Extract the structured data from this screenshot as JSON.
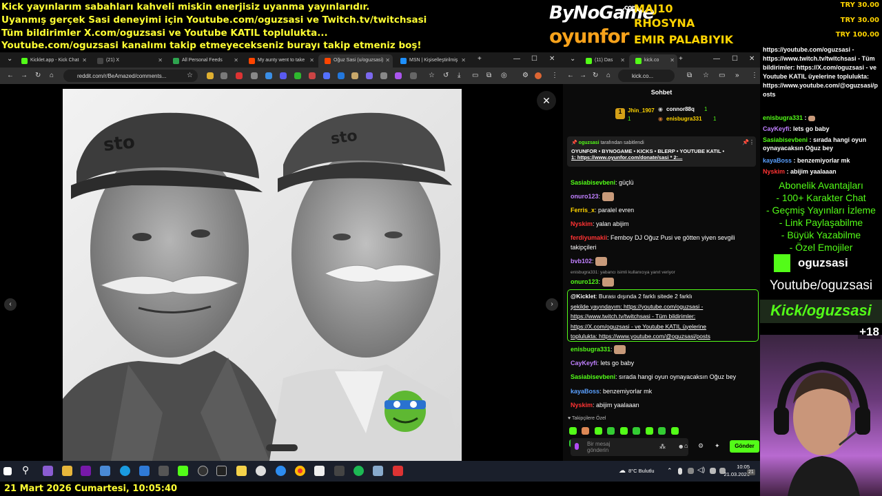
{
  "banner": {
    "lines": [
      "Kick yayınlarım sabahları kahveli miskin enerjisiz uyanma yayınlarıdır.",
      "Uyanmış gerçek Sasi deneyimi için Youtube.com/oguzsasi ve Twitch.tv/twitchsasi",
      "Tüm bildirimler X.com/oguzsasi ve Youtube KATIL toplulukta...",
      "Youtube.com/oguzsasi kanalımı takip etmeyecekseniz burayı takip etmeniz boş!"
    ],
    "logo_bynogame": "ByNoGame",
    "logo_bynogame_suffix": ".com",
    "logo_oyunfor": "oyunfor",
    "donors": [
      {
        "name": "MAJ10",
        "amount": "TRY 30.00"
      },
      {
        "name": "RHOSYNA",
        "amount": "TRY 30.00"
      },
      {
        "name": "EMIR PALABIYIK",
        "amount": "TRY 100.00"
      }
    ]
  },
  "left_browser": {
    "tabs": [
      {
        "label": "Kicklet.app - Kick Chat",
        "color": "#53fc18"
      },
      {
        "label": "(21) X",
        "color": "#000000"
      },
      {
        "label": "All Personal Feeds",
        "color": "#2ea44f"
      },
      {
        "label": "My aunty went to take",
        "color": "#ff4500"
      },
      {
        "label": "Oğuz Sasi (u/oguzsasi)",
        "color": "#ff4500"
      },
      {
        "label": "MSN | Kişiselleştirilmiş",
        "color": "#1e90ff"
      }
    ],
    "url": "reddit.com/r/BeAmazed/comments...",
    "close_label": "✕",
    "prev_label": "‹",
    "next_label": "›"
  },
  "right_browser": {
    "tabs": [
      {
        "label": "(11) Das",
        "color": "#53fc18"
      },
      {
        "label": "kick.co",
        "color": "#53fc18"
      }
    ],
    "url": "kick.co...",
    "chat_title": "Sohbet",
    "podium": {
      "first": {
        "name": "Jhin_1907",
        "count": "1"
      },
      "second": {
        "name": "connor88q",
        "count": "1"
      },
      "third": {
        "name": "enisbugra331",
        "count": "1"
      }
    },
    "pinned": {
      "by": "oguzsasi",
      "by_suffix": "tarafından sabitlendi",
      "line1": "OYUNFOR • BYNOGAME • KICKS • BLERP • YOUTUBE KATIL •",
      "line2": "1: https://www.oyunfor.com/donate/sasi * 2:..."
    },
    "messages": [
      {
        "user": "Sasiabisevbeni",
        "color": "#53fc18",
        "text": "güçlü"
      },
      {
        "user": "onuro123",
        "color": "#53fc18",
        "text": ""
      },
      {
        "user": "Ferris_x",
        "color": "#ffd400",
        "text": "paralel evren"
      },
      {
        "user": "Nyskim",
        "color": "#ff3333",
        "text": "yalan abijim"
      },
      {
        "user": "ferdiyumakii",
        "color": "#ff3333",
        "text": "Femboy DJ Oğuz Pusi ve götten yiyen sevgili takipçileri"
      },
      {
        "user": "bvb102",
        "color": "#c080ff",
        "text": ""
      },
      {
        "user": "onuro123",
        "color": "#53fc18",
        "text": ""
      }
    ],
    "reply_note": "enisbugra331: yabancı isimli kullanıcıya yanıt veriyor",
    "kicklet": {
      "user": "@Kicklet",
      "text1": "Burası dışında 2 farklı sitede 2 farklı",
      "text2": "şekilde yayındayım: https://youtube.com/oguzsasi -",
      "text3": "https://www.twitch.tv/twitchsasi - Tüm bildirimler:",
      "text4": "https://X.com/oguzsasi - ve Youtube KATIL üyelerine",
      "text5": "toplulukta: https://www.youtube.com/@oguzsasi/posts"
    },
    "messages2": [
      {
        "user": "enisbugra331",
        "color": "#53fc18",
        "text": ""
      },
      {
        "user": "CayKeyfi",
        "color": "#c080ff",
        "text": "lets go baby"
      },
      {
        "user": "Sasiabisevbeni",
        "color": "#53fc18",
        "text": "sırada hangi oyun oynayacaksın Oğuz bey"
      },
      {
        "user": "kayaBoss",
        "color": "#5aa0ff",
        "text": "benzemiyorlar mk"
      },
      {
        "user": "Nyskim",
        "color": "#ff3333",
        "text": "abijim yaalaaan"
      }
    ],
    "followers_label": "Takipçilere Özel",
    "input_placeholder": "Bir mesaj gönderin",
    "send_label": "Gönder"
  },
  "side_column": {
    "top_chat": [
      "https://youtube.com/oguzsasi -",
      "https://www.twitch.tv/twitchsasi - Tüm",
      "bildirimler: https://X.com/oguzsasi - ve",
      "Youtube KATIL üyelerine topluluktа:",
      "https://www.youtube.com/@oguzsasi/p",
      "osts"
    ],
    "chat_items": [
      {
        "user": "enisbugra331",
        "color": "#53fc18",
        "text": ""
      },
      {
        "user": "CayKeyfi",
        "color": "#c080ff",
        "text": "lets go baby"
      },
      {
        "user": "Sasiabisevbeni",
        "color": "#53fc18",
        "text": "sırada hangi oyun oynayacaksın Oğuz bey"
      },
      {
        "user": "kayaBoss",
        "color": "#5aa0ff",
        "text": "benzemiyorlar mk"
      },
      {
        "user": "Nyskim",
        "color": "#ff3333",
        "text": "abijim yaalaaan"
      }
    ],
    "perks": [
      "Abonelik Avantajları",
      "- 100+ Karakter Chat",
      "- Geçmiş Yayınları İzleme",
      "- Link Paylaşabilme",
      "- Büyük Yazabilme",
      "- Özel Emojiler"
    ],
    "kick_handle": "oguzsasi",
    "youtube_handle": "Youtube/oguzsasi",
    "kick_banner": "Kick/oguzsasi",
    "viewer_badge": "+18"
  },
  "taskbar": {
    "weather": "8°C  Bulutlu",
    "time": "10:05",
    "date": "21.03.2026",
    "notif": "21"
  },
  "datebar": "21 Mart 2026 Cumartesi, 10:05:40"
}
